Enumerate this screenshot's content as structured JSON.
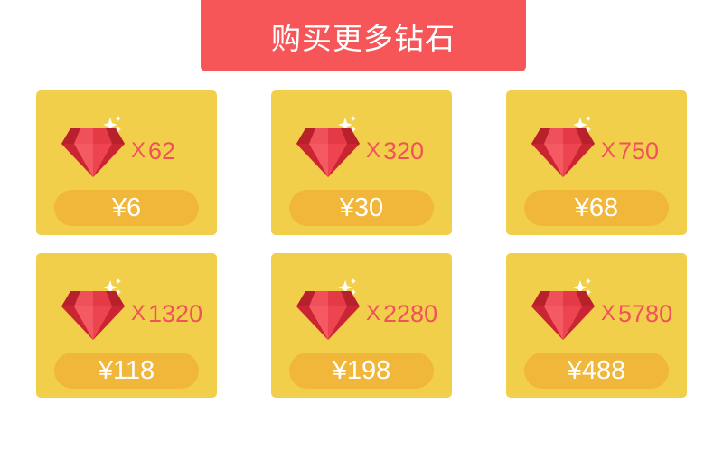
{
  "banner": {
    "title": "购买更多钻石"
  },
  "colors": {
    "banner": "#f75659",
    "card": "#f2cf4a",
    "price_pill": "#f0b73b",
    "quantity_text": "#f0525a",
    "gem": "#e8303f"
  },
  "icons": {
    "gem": "diamond-gem-icon",
    "sparkle": "sparkle-icon"
  },
  "packs": [
    {
      "quantity_prefix": "X",
      "quantity": "62",
      "price": "¥6"
    },
    {
      "quantity_prefix": "X",
      "quantity": "320",
      "price": "¥30"
    },
    {
      "quantity_prefix": "X",
      "quantity": "750",
      "price": "¥68"
    },
    {
      "quantity_prefix": "X",
      "quantity": "1320",
      "price": "¥118"
    },
    {
      "quantity_prefix": "X",
      "quantity": "2280",
      "price": "¥198"
    },
    {
      "quantity_prefix": "X",
      "quantity": "5780",
      "price": "¥488"
    }
  ]
}
